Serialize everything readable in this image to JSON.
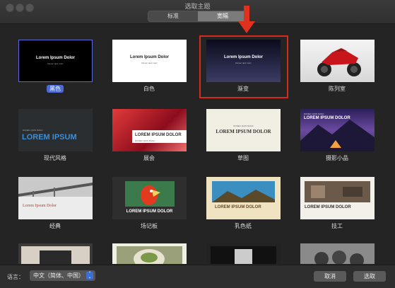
{
  "window": {
    "title": "选取主题"
  },
  "tabs": [
    {
      "label": "标准"
    },
    {
      "label": "宽幅"
    }
  ],
  "themes": [
    {
      "name": "黑色",
      "thumb_title": "Lorem Ipsum Dolor",
      "thumb_sub": "Donec quis nunc"
    },
    {
      "name": "白色",
      "thumb_title": "Lorem Ipsum Dolor",
      "thumb_sub": "Donec quis nunc"
    },
    {
      "name": "渐变",
      "thumb_title": "Lorem Ipsum Dolor",
      "thumb_sub": "Donec quis nunc"
    },
    {
      "name": "陈列室"
    },
    {
      "name": "现代风格",
      "thumb_title": "LOREM IPSUM",
      "thumb_sub": "DONEC QUIS NUNC"
    },
    {
      "name": "展会",
      "thumb_title": "LOREM IPSUM DOLOR",
      "thumb_sub": "DONEC QUIS NUNC"
    },
    {
      "name": "草图",
      "thumb_title": "LOREM IPSUM DOLOR",
      "thumb_sub": "DONEC QUIS NUNC"
    },
    {
      "name": "摄影小品",
      "thumb_title": "LOREM IPSUM DOLOR",
      "thumb_sub": "DONEC QUIS NUNC"
    },
    {
      "name": "经典",
      "thumb_title": "Lorem Ipsum Dolor"
    },
    {
      "name": "场记板",
      "thumb_title": "LOREM IPSUM DOLOR"
    },
    {
      "name": "乳色纸",
      "thumb_title": "LOREM IPSUM DOLOR"
    },
    {
      "name": "技工",
      "thumb_title": "LOREM IPSUM DOLOR"
    }
  ],
  "language": {
    "label": "语言：",
    "value": "中文（简体、中国）"
  },
  "buttons": {
    "cancel": "取消",
    "choose": "选取"
  },
  "colors": {
    "highlight": "#d42b1f",
    "selection": "#4a6ad8",
    "arrow": "#e0301e"
  }
}
